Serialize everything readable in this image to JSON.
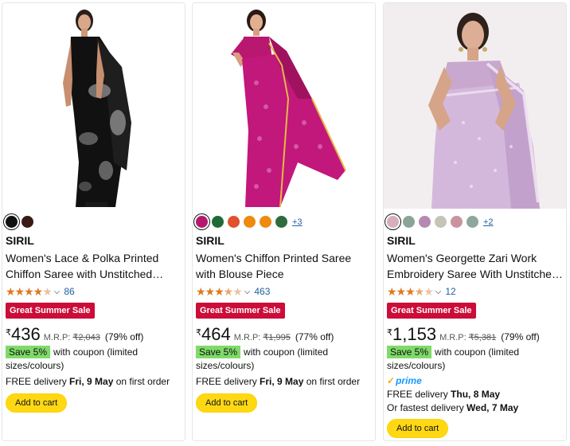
{
  "products": [
    {
      "swatch_colors": [
        "#111111",
        "#3a1a14"
      ],
      "more_colors": "",
      "brand": "SIRIL",
      "title": "Women's Lace & Polka Printed Chiffon Saree with Unstitched Blouse Piece",
      "rating": "4",
      "rating_count": "86",
      "badge": "Great Summer Sale",
      "currency": "₹",
      "price": "436",
      "mrp_label": "M.R.P:",
      "mrp": "₹2,043",
      "discount": "(79% off)",
      "save_label": "Save 5%",
      "coupon_text": "with coupon (limited sizes/colours)",
      "prime": false,
      "delivery_pre": "FREE delivery ",
      "delivery_date": "Fri, 9 May",
      "delivery_post": " on first order",
      "fastest_pre": "",
      "fastest_date": "",
      "button_label": "Add to cart"
    },
    {
      "swatch_colors": [
        "#b4186c",
        "#1f6b35",
        "#e0522c",
        "#ef8a0e",
        "#ef8a0e",
        "#2f6b3c"
      ],
      "more_colors": "+3",
      "brand": "SIRIL",
      "title": "Women's Chiffon Printed Saree with Blouse Piece",
      "rating": "3.5",
      "rating_count": "463",
      "badge": "Great Summer Sale",
      "currency": "₹",
      "price": "464",
      "mrp_label": "M.R.P:",
      "mrp": "₹1,995",
      "discount": "(77% off)",
      "save_label": "Save 5%",
      "coupon_text": "with coupon (limited sizes/colours)",
      "prime": false,
      "delivery_pre": "FREE delivery ",
      "delivery_date": "Fri, 9 May",
      "delivery_post": " on first order",
      "fastest_pre": "",
      "fastest_date": "",
      "button_label": "Add to cart"
    },
    {
      "swatch_colors": [
        "#d7aebd",
        "#8aa597",
        "#b58ab2",
        "#c4c4b8",
        "#c9939f",
        "#8ea69b"
      ],
      "more_colors": "+2",
      "brand": "SIRIL",
      "title": "Women's Georgette Zari Work Embroidery Saree With Unstitched Blouse Piece",
      "rating": "3.5",
      "rating_count": "12",
      "badge": "Great Summer Sale",
      "currency": "₹",
      "price": "1,153",
      "mrp_label": "M.R.P:",
      "mrp": "₹5,381",
      "discount": "(79% off)",
      "save_label": "Save 5%",
      "coupon_text": "with coupon (limited sizes/colours)",
      "prime": true,
      "prime_label": "prime",
      "delivery_pre": "FREE delivery ",
      "delivery_date": "Thu, 8 May",
      "delivery_post": "",
      "fastest_pre": "Or fastest delivery ",
      "fastest_date": "Wed, 7 May",
      "button_label": "Add to cart"
    }
  ],
  "icons": {
    "star": "star-icon",
    "chevron": "chevron-down-icon",
    "prime_check": "prime-check-icon"
  }
}
